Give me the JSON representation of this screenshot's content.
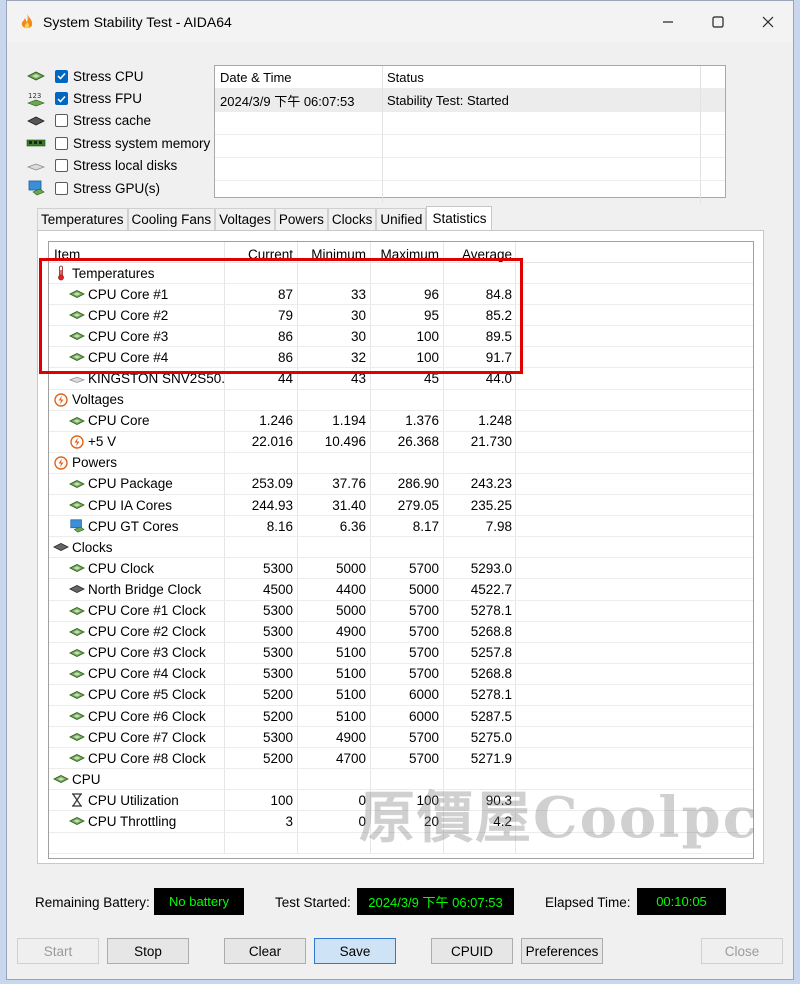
{
  "window": {
    "title": "System Stability Test - AIDA64",
    "controls": {
      "minimize": "—",
      "maximize": "☐",
      "close": "✕"
    }
  },
  "stress_options": [
    {
      "label": "Stress CPU",
      "checked": true,
      "icon": "cpu-chip-icon"
    },
    {
      "label": "Stress FPU",
      "checked": true,
      "icon": "fpu-123-icon"
    },
    {
      "label": "Stress cache",
      "checked": false,
      "icon": "cache-chip-icon"
    },
    {
      "label": "Stress system memory",
      "checked": false,
      "icon": "memory-module-icon"
    },
    {
      "label": "Stress local disks",
      "checked": false,
      "icon": "disk-drive-icon"
    },
    {
      "label": "Stress GPU(s)",
      "checked": false,
      "icon": "gpu-monitor-icon"
    }
  ],
  "log": {
    "headers": {
      "datetime": "Date & Time",
      "status": "Status"
    },
    "entries": [
      {
        "datetime": "2024/3/9 下午 06:07:53",
        "status": "Stability Test: Started"
      }
    ]
  },
  "tabs": [
    "Temperatures",
    "Cooling Fans",
    "Voltages",
    "Powers",
    "Clocks",
    "Unified",
    "Statistics"
  ],
  "active_tab": "Statistics",
  "statistics": {
    "headers": {
      "item": "Item",
      "current": "Current",
      "minimum": "Minimum",
      "maximum": "Maximum",
      "average": "Average"
    },
    "rows": [
      {
        "type": "group",
        "item": "Temperatures",
        "icon": "thermometer-icon"
      },
      {
        "type": "item",
        "item": "CPU Core #1",
        "icon": "cpu-chip-icon",
        "current": "87",
        "minimum": "33",
        "maximum": "96",
        "average": "84.8"
      },
      {
        "type": "item",
        "item": "CPU Core #2",
        "icon": "cpu-chip-icon",
        "current": "79",
        "minimum": "30",
        "maximum": "95",
        "average": "85.2"
      },
      {
        "type": "item",
        "item": "CPU Core #3",
        "icon": "cpu-chip-icon",
        "current": "86",
        "minimum": "30",
        "maximum": "100",
        "average": "89.5"
      },
      {
        "type": "item",
        "item": "CPU Core #4",
        "icon": "cpu-chip-icon",
        "current": "86",
        "minimum": "32",
        "maximum": "100",
        "average": "91.7"
      },
      {
        "type": "item",
        "item": "KINGSTON SNV2S50...",
        "icon": "disk-drive-icon",
        "current": "44",
        "minimum": "43",
        "maximum": "45",
        "average": "44.0"
      },
      {
        "type": "group",
        "item": "Voltages",
        "icon": "power-bolt-icon"
      },
      {
        "type": "item",
        "item": "CPU Core",
        "icon": "cpu-chip-icon",
        "current": "1.246",
        "minimum": "1.194",
        "maximum": "1.376",
        "average": "1.248"
      },
      {
        "type": "item",
        "item": "+5 V",
        "icon": "power-bolt-icon",
        "current": "22.016",
        "minimum": "10.496",
        "maximum": "26.368",
        "average": "21.730"
      },
      {
        "type": "group",
        "item": "Powers",
        "icon": "power-bolt-icon"
      },
      {
        "type": "item",
        "item": "CPU Package",
        "icon": "cpu-chip-icon",
        "current": "253.09",
        "minimum": "37.76",
        "maximum": "286.90",
        "average": "243.23"
      },
      {
        "type": "item",
        "item": "CPU IA Cores",
        "icon": "cpu-chip-icon",
        "current": "244.93",
        "minimum": "31.40",
        "maximum": "279.05",
        "average": "235.25"
      },
      {
        "type": "item",
        "item": "CPU GT Cores",
        "icon": "gpu-monitor-icon",
        "current": "8.16",
        "minimum": "6.36",
        "maximum": "8.17",
        "average": "7.98"
      },
      {
        "type": "group",
        "item": "Clocks",
        "icon": "clock-chip-icon"
      },
      {
        "type": "item",
        "item": "CPU Clock",
        "icon": "cpu-chip-icon",
        "current": "5300",
        "minimum": "5000",
        "maximum": "5700",
        "average": "5293.0"
      },
      {
        "type": "item",
        "item": "North Bridge Clock",
        "icon": "clock-chip-icon",
        "current": "4500",
        "minimum": "4400",
        "maximum": "5000",
        "average": "4522.7"
      },
      {
        "type": "item",
        "item": "CPU Core #1 Clock",
        "icon": "cpu-chip-icon",
        "current": "5300",
        "minimum": "5000",
        "maximum": "5700",
        "average": "5278.1"
      },
      {
        "type": "item",
        "item": "CPU Core #2 Clock",
        "icon": "cpu-chip-icon",
        "current": "5300",
        "minimum": "4900",
        "maximum": "5700",
        "average": "5268.8"
      },
      {
        "type": "item",
        "item": "CPU Core #3 Clock",
        "icon": "cpu-chip-icon",
        "current": "5300",
        "minimum": "5100",
        "maximum": "5700",
        "average": "5257.8"
      },
      {
        "type": "item",
        "item": "CPU Core #4 Clock",
        "icon": "cpu-chip-icon",
        "current": "5300",
        "minimum": "5100",
        "maximum": "5700",
        "average": "5268.8"
      },
      {
        "type": "item",
        "item": "CPU Core #5 Clock",
        "icon": "cpu-chip-icon",
        "current": "5200",
        "minimum": "5100",
        "maximum": "6000",
        "average": "5278.1"
      },
      {
        "type": "item",
        "item": "CPU Core #6 Clock",
        "icon": "cpu-chip-icon",
        "current": "5200",
        "minimum": "5100",
        "maximum": "6000",
        "average": "5287.5"
      },
      {
        "type": "item",
        "item": "CPU Core #7 Clock",
        "icon": "cpu-chip-icon",
        "current": "5300",
        "minimum": "4900",
        "maximum": "5700",
        "average": "5275.0"
      },
      {
        "type": "item",
        "item": "CPU Core #8 Clock",
        "icon": "cpu-chip-icon",
        "current": "5200",
        "minimum": "4700",
        "maximum": "5700",
        "average": "5271.9"
      },
      {
        "type": "group",
        "item": "CPU",
        "icon": "cpu-chip-icon"
      },
      {
        "type": "item",
        "item": "CPU Utilization",
        "icon": "hourglass-icon",
        "current": "100",
        "minimum": "0",
        "maximum": "100",
        "average": "90.3"
      },
      {
        "type": "item",
        "item": "CPU Throttling",
        "icon": "cpu-chip-icon",
        "current": "3",
        "minimum": "0",
        "maximum": "20",
        "average": "4.2"
      }
    ]
  },
  "watermark": "原價屋Coolpc",
  "status": {
    "battery_label": "Remaining Battery:",
    "battery_value": "No battery",
    "started_label": "Test Started:",
    "started_value": "2024/3/9 下午 06:07:53",
    "elapsed_label": "Elapsed Time:",
    "elapsed_value": "00:10:05"
  },
  "buttons": {
    "start": "Start",
    "stop": "Stop",
    "clear": "Clear",
    "save": "Save",
    "cpuid": "CPUID",
    "preferences": "Preferences",
    "close": "Close"
  },
  "colors": {
    "highlight": "#e00000",
    "checkbox_checked": "#0067c0",
    "status_text": "#00ff00",
    "status_bg": "#000000"
  }
}
